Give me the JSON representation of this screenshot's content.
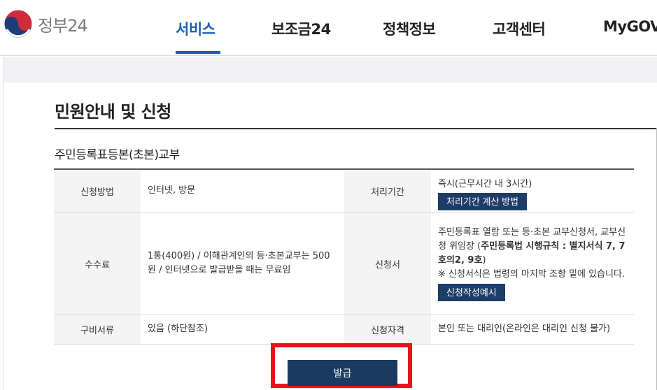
{
  "header": {
    "logo_text": "정부24",
    "nav": [
      {
        "label": "서비스",
        "active": true
      },
      {
        "label": "보조금24",
        "active": false
      },
      {
        "label": "정책정보",
        "active": false
      },
      {
        "label": "고객센터",
        "active": false
      },
      {
        "label": "MyGOV",
        "active": false
      }
    ],
    "active_color": "#1a5fb4"
  },
  "main": {
    "page_title": "민원안내 및 신청",
    "section_title": "주민등록표등본(초본)교부",
    "rows": {
      "apply_method": {
        "label": "신청방법",
        "value": "인터넷, 방문"
      },
      "processing_time": {
        "label": "처리기간",
        "value": "즉시(근무시간 내 3시간)",
        "button": "처리기간 계산 방법"
      },
      "fee": {
        "label": "수수료",
        "value": "1통(400원) / 이해관계인의 등·초본교부는 500원 / 인터넷으로 발급받을 때는 무료임"
      },
      "application_form": {
        "label": "신청서",
        "text_1": "주민등록표 열람 또는 등·초본 교부신청서, 교부신청 위임장 (",
        "text_bold": "주민등록법 시행규칙 : 별지서식 7, 7호의2, 9호",
        "text_2": ")",
        "note": "※ 신청서식은 법령의 마지막 조항 밑에 있습니다.",
        "button": "신청작성예시"
      },
      "documents": {
        "label": "구비서류",
        "value": "있음 (하단참조)"
      },
      "eligibility": {
        "label": "신청자격",
        "value": "본인 또는 대리인(온라인은 대리인 신청 불가)"
      }
    },
    "issue_button": "발급",
    "highlight_color": "#e8141b"
  }
}
